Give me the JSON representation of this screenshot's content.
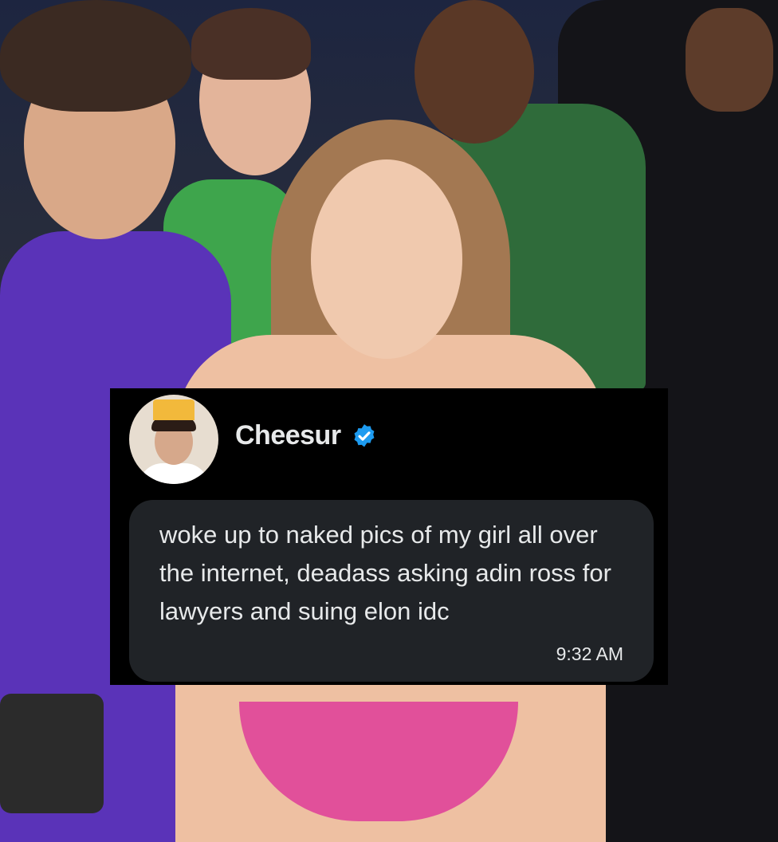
{
  "post": {
    "display_name": "Cheesur",
    "verified_badge": "verified-check-icon",
    "text": "woke up to naked pics of my girl all over the internet, deadass asking adin ross for lawyers and suing elon idc",
    "time": "9:32 AM"
  },
  "colors": {
    "card_background": "#000000",
    "bubble_background": "#202327",
    "text": "#e7e9ea",
    "verified_blue": "#1d9bf0"
  }
}
